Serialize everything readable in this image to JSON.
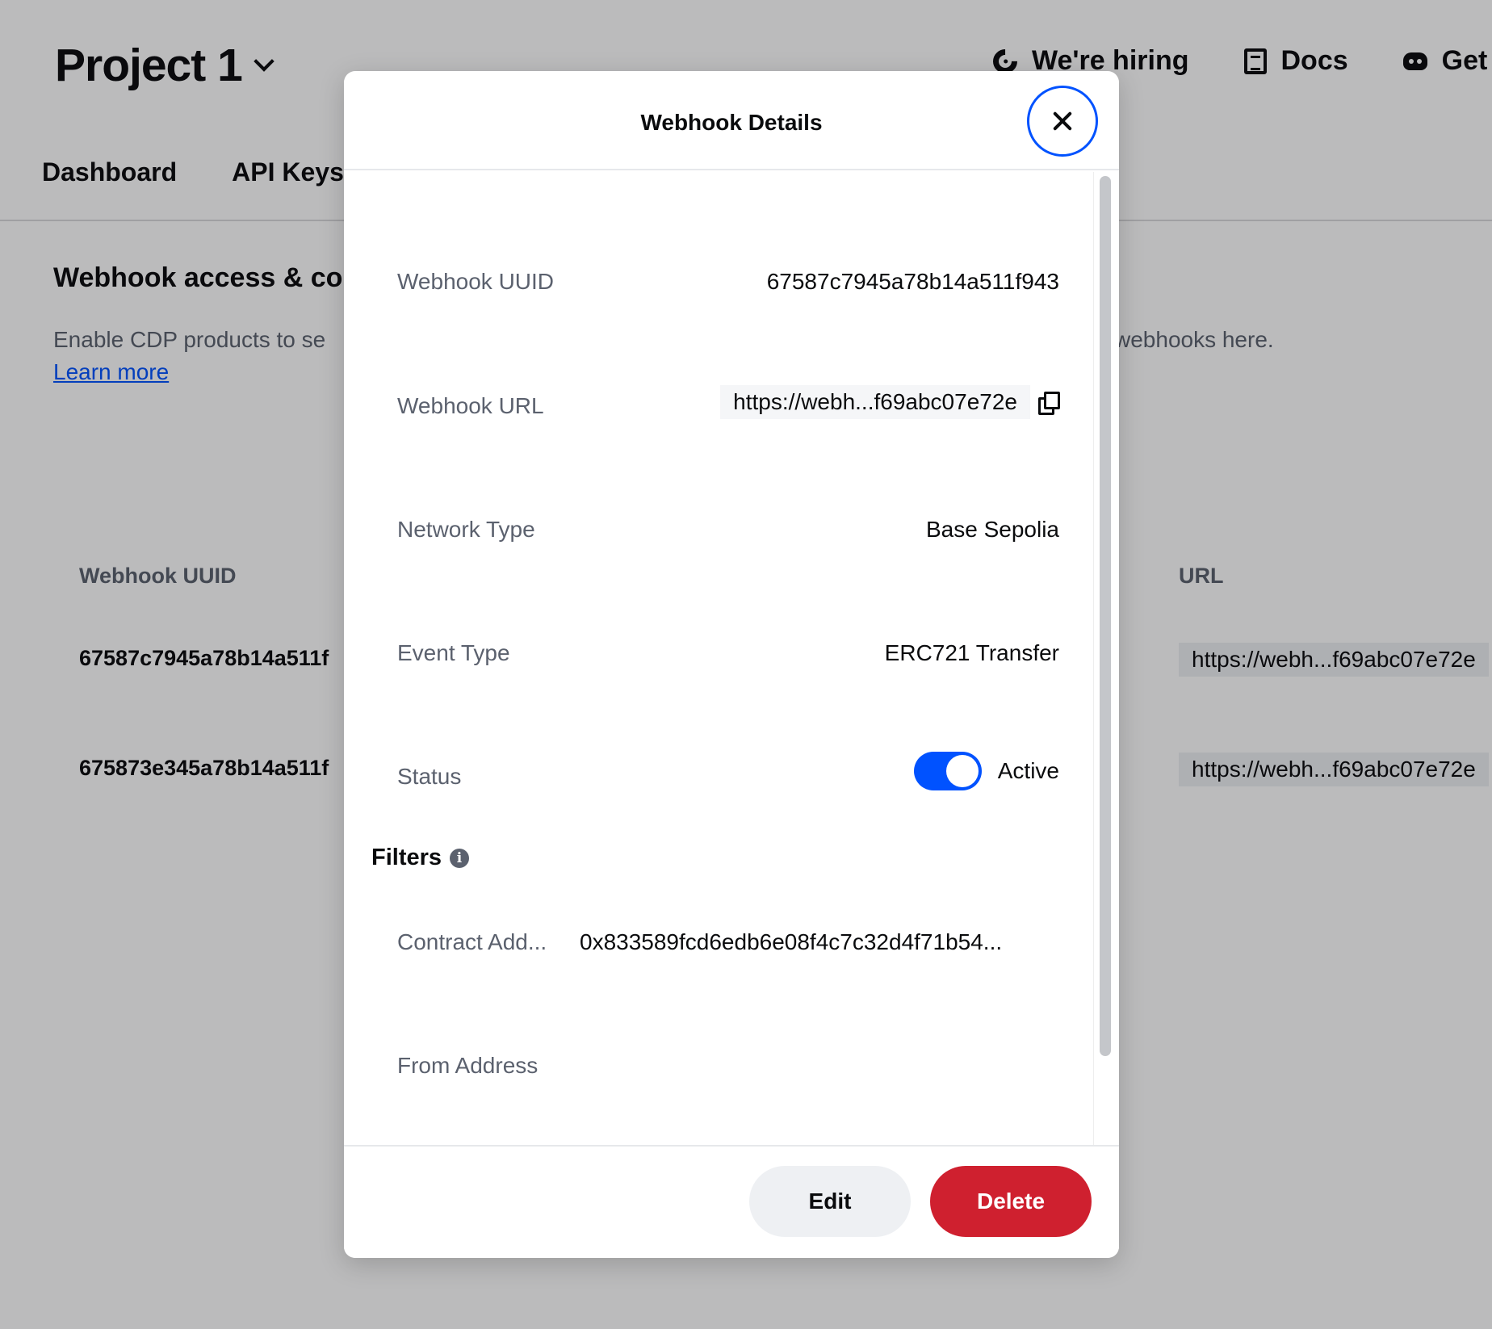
{
  "app": {
    "project_name": "Project 1",
    "top_links": [
      {
        "label": "We're hiring",
        "icon": "hiring-icon"
      },
      {
        "label": "Docs",
        "icon": "docs-icon"
      },
      {
        "label": "Get h",
        "icon": "discord-icon"
      }
    ],
    "tabs": [
      "Dashboard",
      "API Keys"
    ],
    "section": {
      "title": "Webhook access & co",
      "description_start": "Enable CDP products to se",
      "description_end": "webhooks here.",
      "learn_more": "Learn more"
    },
    "table": {
      "columns": [
        "Webhook UUID",
        "URL"
      ],
      "rows": [
        {
          "uuid": "67587c7945a78b14a511f",
          "url": "https://webh...f69abc07e72e"
        },
        {
          "uuid": "675873e345a78b14a511f",
          "url": "https://webh...f69abc07e72e"
        }
      ]
    }
  },
  "modal": {
    "title": "Webhook Details",
    "fields": {
      "uuid": {
        "label": "Webhook UUID",
        "value": "67587c7945a78b14a511f943"
      },
      "url": {
        "label": "Webhook URL",
        "value": "https://webh...f69abc07e72e"
      },
      "network": {
        "label": "Network Type",
        "value": "Base Sepolia"
      },
      "event": {
        "label": "Event Type",
        "value": "ERC721 Transfer"
      },
      "status": {
        "label": "Status",
        "value": "Active",
        "enabled": true
      }
    },
    "filters": {
      "title": "Filters",
      "contract": {
        "label": "Contract Add...",
        "value": "0x833589fcd6edb6e08f4c7c32d4f71b54..."
      },
      "from": {
        "label": "From Address",
        "value": ""
      }
    },
    "buttons": {
      "edit": "Edit",
      "delete": "Delete"
    }
  },
  "colors": {
    "accent": "#0052ff",
    "danger": "#cf202f",
    "muted_text": "#5b616e"
  }
}
